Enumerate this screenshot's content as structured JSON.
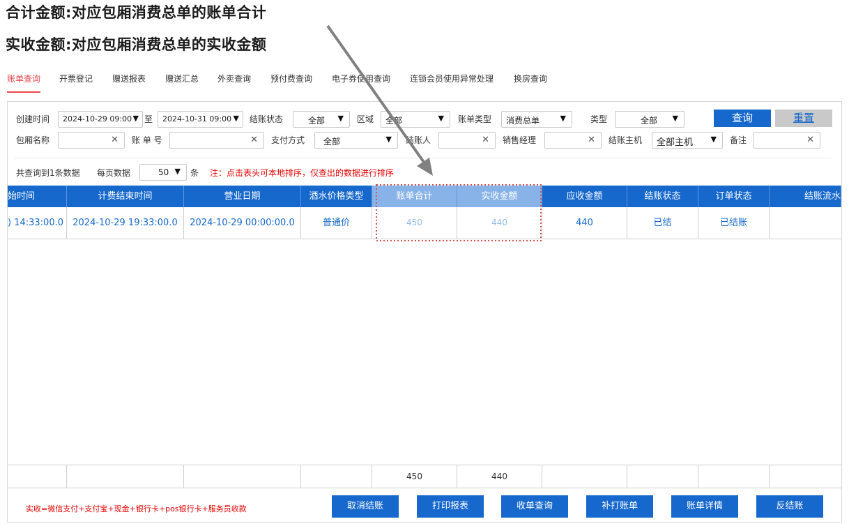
{
  "notes": {
    "line1": "合计金额:对应包厢消费总单的账单合计",
    "line2": "实收金额:对应包厢消费总单的实收金额"
  },
  "tabs": [
    {
      "label": "账单查询",
      "active": true
    },
    {
      "label": "开票登记"
    },
    {
      "label": "赠送报表"
    },
    {
      "label": "赠送汇总"
    },
    {
      "label": "外卖查询"
    },
    {
      "label": "预付费查询"
    },
    {
      "label": "电子券使用查询"
    },
    {
      "label": "连锁会员使用异常处理"
    },
    {
      "label": "换房查询"
    }
  ],
  "filters": {
    "create_time_label": "创建时间",
    "create_from": "2024-10-29 09:00",
    "to_label": "至",
    "create_to": "2024-10-31 09:00",
    "settle_status_label": "结账状态",
    "settle_status": "全部",
    "area_label": "区域",
    "area": "全部",
    "bill_type_label": "账单类型",
    "bill_type": "消费总单",
    "type_label": "类型",
    "type": "全部",
    "room_name_label": "包厢名称",
    "room_name": "",
    "bill_no_label": "账 单 号",
    "bill_no": "",
    "pay_method_label": "支付方式",
    "pay_method": "全部",
    "cashier_label": "结账人",
    "cashier": "",
    "sales_mgr_label": "销售经理",
    "sales_mgr": "",
    "host_label": "结账主机",
    "host": "全部主机",
    "remark_label": "备注",
    "remark": "",
    "query_button": "查询",
    "reset_button": "重置"
  },
  "paging": {
    "count_text": "共查询到1条数据",
    "per_page_label": "每页数据",
    "per_page": "50",
    "unit": "条",
    "sort_hint": "注：点击表头可本地排序，仅查出的数据进行排序"
  },
  "table": {
    "columns": [
      "始时间",
      "计费结束时间",
      "营业日期",
      "酒水价格类型",
      "账单合计",
      "实收金额",
      "应收金额",
      "结账状态",
      "订单状态",
      "结账流水"
    ],
    "rows": [
      [
        ") 14:33:00.0",
        "2024-10-29 19:33:00.0",
        "2024-10-29 00:00:00.0",
        "普通价",
        "450",
        "440",
        "440",
        "已结",
        "已结账",
        ""
      ]
    ],
    "footer": [
      "",
      "",
      "",
      "",
      "450",
      "440",
      "",
      "",
      "",
      ""
    ]
  },
  "bottom": {
    "note": "实收=微信支付+支付宝+现金+银行卡+pos银行卡+服务员收款",
    "buttons": [
      "取消结账",
      "打印报表",
      "收单查询",
      "补打账单",
      "账单详情",
      "反结账"
    ]
  },
  "colors": {
    "primary": "#1668cc",
    "highlight_header": "#88b3e8",
    "active_tab": "#e8474c",
    "warning": "#e60000",
    "annotation": "#808080",
    "dotted_box": "#d9534f"
  }
}
